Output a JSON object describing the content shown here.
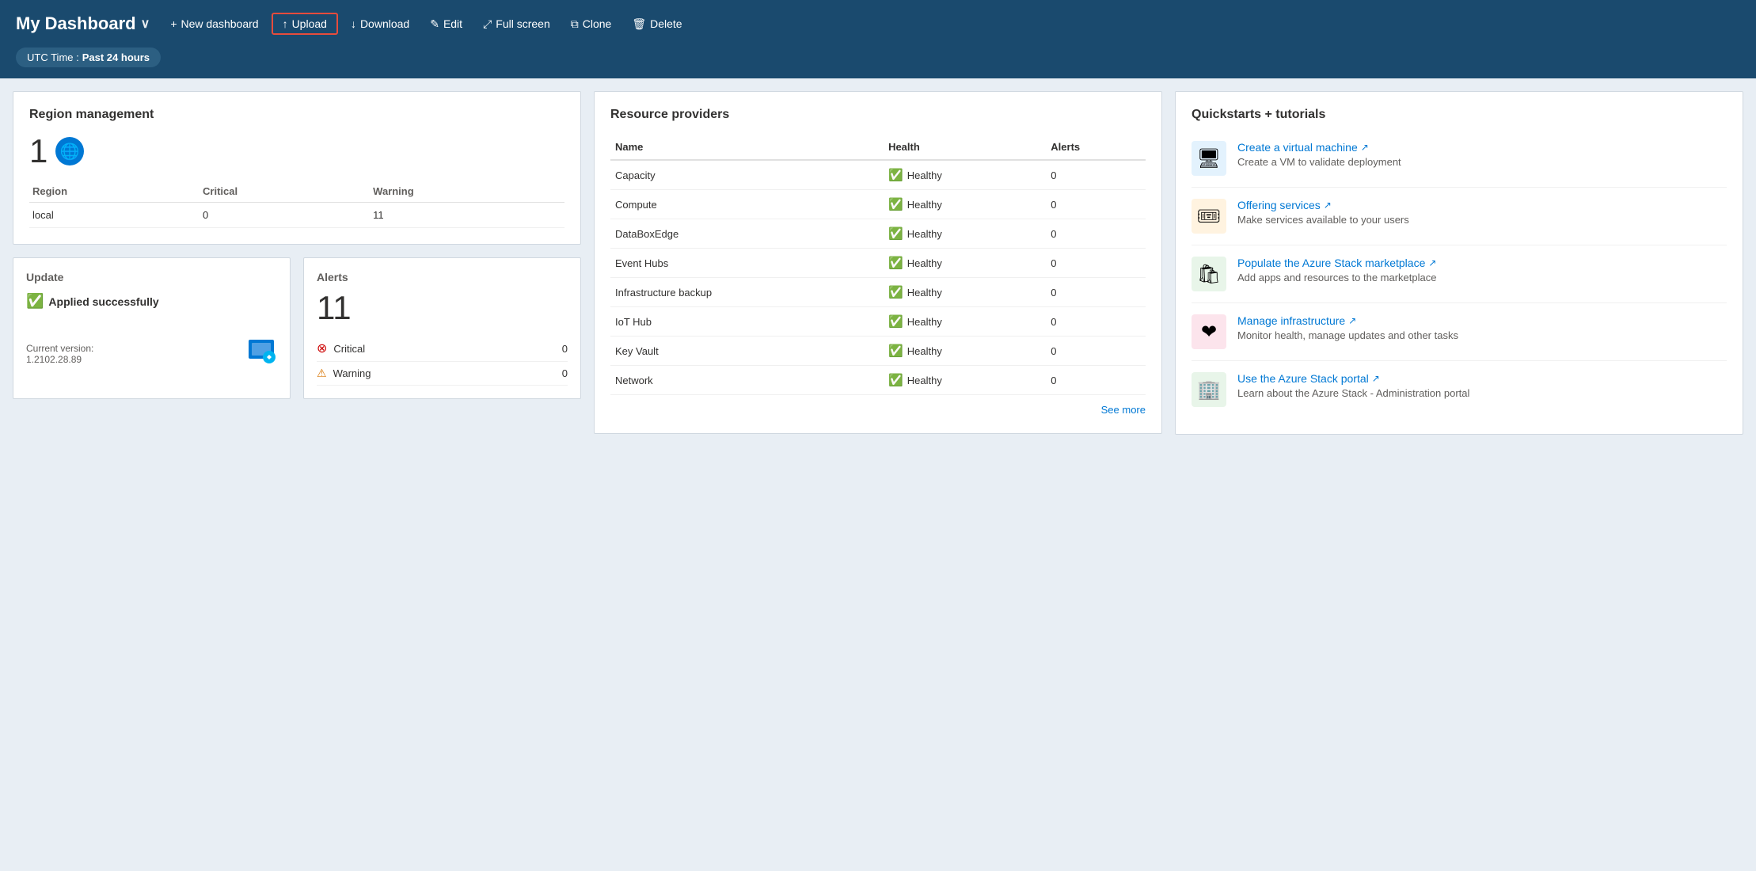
{
  "header": {
    "title": "My Dashboard",
    "actions": [
      {
        "id": "new-dashboard",
        "label": "New dashboard",
        "icon": "+"
      },
      {
        "id": "upload",
        "label": "Upload",
        "icon": "↑"
      },
      {
        "id": "download",
        "label": "Download",
        "icon": "↓"
      },
      {
        "id": "edit",
        "label": "Edit",
        "icon": "✎"
      },
      {
        "id": "fullscreen",
        "label": "Full screen",
        "icon": "⤢"
      },
      {
        "id": "clone",
        "label": "Clone",
        "icon": "⧉"
      },
      {
        "id": "delete",
        "label": "Delete",
        "icon": "🗑"
      }
    ]
  },
  "utc": {
    "label": "UTC Time :",
    "value": "Past 24 hours"
  },
  "region_management": {
    "title": "Region management",
    "count": "1",
    "table": {
      "headers": [
        "Region",
        "Critical",
        "Warning"
      ],
      "rows": [
        {
          "region": "local",
          "critical": "0",
          "warning": "11"
        }
      ]
    }
  },
  "update": {
    "title": "Update",
    "status": "Applied successfully",
    "version_label": "Current version:",
    "version": "1.2102.28.89"
  },
  "alerts": {
    "title": "Alerts",
    "count": "11",
    "items": [
      {
        "type": "Critical",
        "count": "0"
      },
      {
        "type": "Warning",
        "count": "0"
      }
    ]
  },
  "resource_providers": {
    "title": "Resource providers",
    "headers": [
      "Name",
      "Health",
      "Alerts"
    ],
    "rows": [
      {
        "name": "Capacity",
        "health": "Healthy",
        "alerts": "0"
      },
      {
        "name": "Compute",
        "health": "Healthy",
        "alerts": "0"
      },
      {
        "name": "DataBoxEdge",
        "health": "Healthy",
        "alerts": "0"
      },
      {
        "name": "Event Hubs",
        "health": "Healthy",
        "alerts": "0"
      },
      {
        "name": "Infrastructure backup",
        "health": "Healthy",
        "alerts": "0"
      },
      {
        "name": "IoT Hub",
        "health": "Healthy",
        "alerts": "0"
      },
      {
        "name": "Key Vault",
        "health": "Healthy",
        "alerts": "0"
      },
      {
        "name": "Network",
        "health": "Healthy",
        "alerts": "0"
      }
    ],
    "see_more": "See more"
  },
  "quickstarts": {
    "title": "Quickstarts + tutorials",
    "items": [
      {
        "id": "create-vm",
        "label": "Create a virtual machine",
        "description": "Create a VM to validate deployment",
        "icon": "🖥"
      },
      {
        "id": "offering-services",
        "label": "Offering services",
        "description": "Make services available to your users",
        "icon": "🎟"
      },
      {
        "id": "marketplace",
        "label": "Populate the Azure Stack marketplace",
        "description": "Add apps and resources to the marketplace",
        "icon": "🛍"
      },
      {
        "id": "manage-infra",
        "label": "Manage infrastructure",
        "description": "Monitor health, manage updates and other tasks",
        "icon": "❤"
      },
      {
        "id": "azure-portal",
        "label": "Use the Azure Stack portal",
        "description": "Learn about the Azure Stack - Administration portal",
        "icon": "🏢"
      }
    ]
  }
}
